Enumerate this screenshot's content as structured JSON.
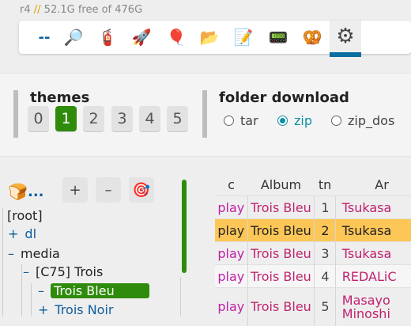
{
  "status": {
    "prefix": "r4",
    "sep": "//",
    "free": "52.1G free of 476G"
  },
  "toolbar": {
    "icons": [
      {
        "name": "dash",
        "glyph": "--"
      },
      {
        "name": "search-icon",
        "glyph": "🔎"
      },
      {
        "name": "fire-extinguisher-icon",
        "glyph": "🧯"
      },
      {
        "name": "rocket-icon",
        "glyph": "🚀"
      },
      {
        "name": "balloon-icon",
        "glyph": "🎈"
      },
      {
        "name": "folder-icon",
        "glyph": "📂"
      },
      {
        "name": "memo-icon",
        "glyph": "📝"
      },
      {
        "name": "pager-icon",
        "glyph": "📟"
      },
      {
        "name": "pretzel-icon",
        "glyph": "🥨"
      },
      {
        "name": "gear-icon",
        "glyph": "⚙"
      }
    ]
  },
  "themes": {
    "title": "themes",
    "options": [
      "0",
      "1",
      "2",
      "3",
      "4",
      "5"
    ],
    "selected": "1"
  },
  "folder_download": {
    "title": "folder download",
    "options": [
      "tar",
      "zip",
      "zip_dos"
    ],
    "selected": "zip"
  },
  "tree": {
    "toolbar": {
      "bread_icon": "🍞",
      "ellipsis": "...",
      "plus": "+",
      "minus": "–",
      "target_icon": "🎯"
    },
    "nodes": [
      {
        "label": "[root]",
        "toggle": ""
      },
      {
        "label": "dl",
        "toggle": "+"
      },
      {
        "label": "media",
        "toggle": "–"
      },
      {
        "label": "[C75] Trois",
        "toggle": "–"
      },
      {
        "label": "Trois Bleu",
        "toggle": "–"
      },
      {
        "label": "Trois Noir",
        "toggle": "+"
      }
    ]
  },
  "table": {
    "headers": [
      "c",
      "Album",
      "tn",
      "Ar"
    ],
    "rows": [
      {
        "c": "play",
        "album": "Trois Bleu",
        "tn": "1",
        "artist": "Tsukasa"
      },
      {
        "c": "play",
        "album": "Trois Bleu",
        "tn": "2",
        "artist": "Tsukasa"
      },
      {
        "c": "play",
        "album": "Trois Bleu",
        "tn": "3",
        "artist": "Tsukasa"
      },
      {
        "c": "play",
        "album": "Trois Bleu",
        "tn": "4",
        "artist": "REDALiC"
      },
      {
        "c": "play",
        "album": "Trois Bleu",
        "tn": "5",
        "artist": "Masayo",
        "artist2": "Minoshi"
      }
    ]
  },
  "colors": {
    "accent": "#2e8b0c",
    "active_tab": "#0b6ea1",
    "highlight": "#fdc757",
    "link": "#0d5d9b"
  }
}
